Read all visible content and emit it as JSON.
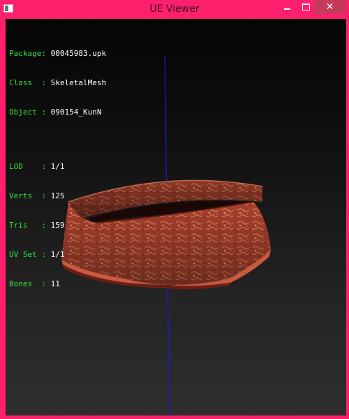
{
  "window": {
    "title": "UE Viewer",
    "close_glyph": "✕",
    "colors": {
      "frame": "#ff1f6d",
      "close": "#c7395a"
    }
  },
  "info": {
    "package_label": "Package:",
    "package_value": "00045983.upk",
    "class_label": "Class  :",
    "class_value": "SkeletalMesh",
    "object_label": "Object :",
    "object_value": "090154_KunN",
    "lod_label": "LOD    :",
    "lod_value": "1/1",
    "verts_label": "Verts  :",
    "verts_value": "125",
    "tris_label": "Tris   :",
    "tris_value": "159",
    "uvset_label": "UV Set :",
    "uvset_value": "1/1",
    "bones_label": "Bones  :",
    "bones_value": "11",
    "colors": {
      "label": "#33e03a",
      "value": "#ffffff"
    }
  },
  "scene": {
    "mesh": "ornate-red-collar-mesh",
    "axis_color": "#1020c8"
  }
}
